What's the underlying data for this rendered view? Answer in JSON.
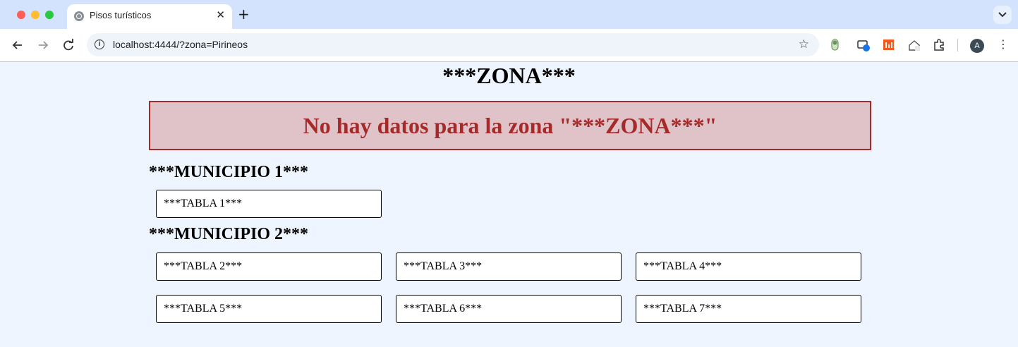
{
  "browser": {
    "tab_title": "Pisos turísticos",
    "tab_close": "✕",
    "new_tab": "+",
    "url": "localhost:4444/?zona=Pirineos",
    "avatar_letter": "A",
    "menu": "⋮",
    "star": "☆",
    "info": "i"
  },
  "page": {
    "zona_title": "***ZONA***",
    "error_message": "No hay datos para la zona \"***ZONA***\"",
    "municipios": [
      {
        "name": "***MUNICIPIO 1***",
        "tablas": [
          "***TABLA 1***"
        ]
      },
      {
        "name": "***MUNICIPIO 2***",
        "tablas": [
          "***TABLA 2***",
          "***TABLA 3***",
          "***TABLA 4***",
          "***TABLA 5***",
          "***TABLA 6***",
          "***TABLA 7***"
        ]
      }
    ]
  },
  "colors": {
    "page_background": "#eef5ff",
    "error_text": "#a52a2a",
    "error_background": "#dfc3c8"
  }
}
